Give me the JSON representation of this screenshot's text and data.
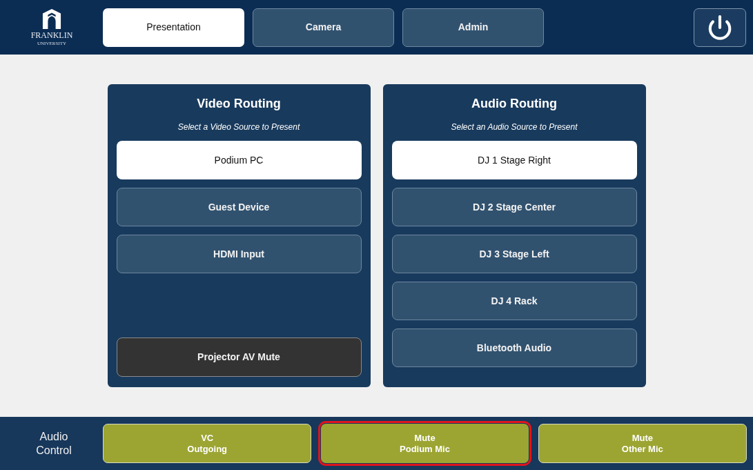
{
  "header": {
    "logo": {
      "name": "FRANKLIN",
      "subtitle": "UNIVERSITY"
    },
    "tabs": [
      {
        "label": "Presentation",
        "selected": true
      },
      {
        "label": "Camera",
        "selected": false
      },
      {
        "label": "Admin",
        "selected": false
      }
    ]
  },
  "video_routing": {
    "title": "Video Routing",
    "subtitle": "Select a Video Source to Present",
    "sources": [
      {
        "label": "Podium PC",
        "selected": true
      },
      {
        "label": "Guest Device",
        "selected": false
      },
      {
        "label": "HDMI Input",
        "selected": false
      }
    ],
    "mute_button": {
      "label": "Projector AV Mute"
    }
  },
  "audio_routing": {
    "title": "Audio Routing",
    "subtitle": "Select an Audio Source to Present",
    "sources": [
      {
        "label": "DJ 1 Stage Right",
        "selected": true
      },
      {
        "label": "DJ 2 Stage Center",
        "selected": false
      },
      {
        "label": "DJ 3 Stage Left",
        "selected": false
      },
      {
        "label": "DJ 4 Rack",
        "selected": false
      },
      {
        "label": "Bluetooth Audio",
        "selected": false
      }
    ]
  },
  "audio_control": {
    "label": "Audio Control",
    "buttons": [
      {
        "lines": [
          "VC",
          "Outgoing"
        ],
        "highlighted": false
      },
      {
        "lines": [
          "Mute",
          "Podium Mic"
        ],
        "highlighted": true
      },
      {
        "lines": [
          "Mute",
          "Other Mic"
        ],
        "highlighted": false
      }
    ]
  }
}
